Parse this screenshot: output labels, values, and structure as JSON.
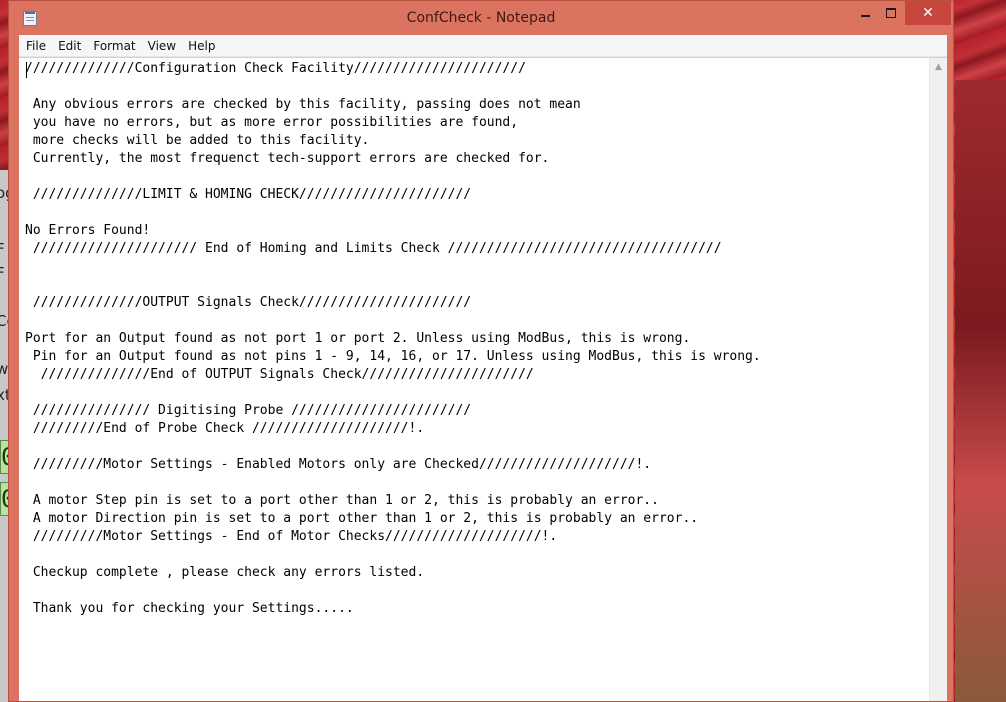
{
  "window": {
    "title": "ConfCheck - Notepad"
  },
  "menu": {
    "items": [
      "File",
      "Edit",
      "Format",
      "View",
      "Help"
    ]
  },
  "document": {
    "lines": [
      "//////////////Configuration Check Facility//////////////////////",
      "",
      " Any obvious errors are checked by this facility, passing does not mean",
      " you have no errors, but as more error possibilities are found,",
      " more checks will be added to this facility.",
      " Currently, the most frequenct tech-support errors are checked for.",
      "",
      " //////////////LIMIT & HOMING CHECK//////////////////////",
      "",
      "No Errors Found!",
      " ///////////////////// End of Homing and Limits Check ///////////////////////////////////",
      "",
      "",
      " //////////////OUTPUT Signals Check//////////////////////",
      "",
      "Port for an Output found as not port 1 or port 2. Unless using ModBus, this is wrong.",
      " Pin for an Output found as not pins 1 - 9, 14, 16, or 17. Unless using ModBus, this is wrong.",
      "  //////////////End of OUTPUT Signals Check//////////////////////",
      "",
      " /////////////// Digitising Probe ///////////////////////",
      " /////////End of Probe Check ////////////////////!.",
      "",
      " /////////Motor Settings - Enabled Motors only are Checked////////////////////!.",
      "",
      " A motor Step pin is set to a port other than 1 or 2, this is probably an error..",
      " A motor Direction pin is set to a port other than 1 or 2, this is probably an error..",
      " /////////Motor Settings - End of Motor Checks////////////////////!.",
      "",
      " Checkup complete , please check any errors listed.",
      "",
      " Thank you for checking your Settings....."
    ]
  },
  "background": {
    "left_fragments": [
      "og",
      "F",
      "F",
      "Co",
      "w",
      "xt"
    ],
    "left_digits": [
      "0",
      "0"
    ]
  },
  "colors": {
    "titlebar": "#dc7260",
    "close_button": "#c7463d",
    "menubar": "#f5f6f7",
    "editor_bg": "#ffffff"
  }
}
